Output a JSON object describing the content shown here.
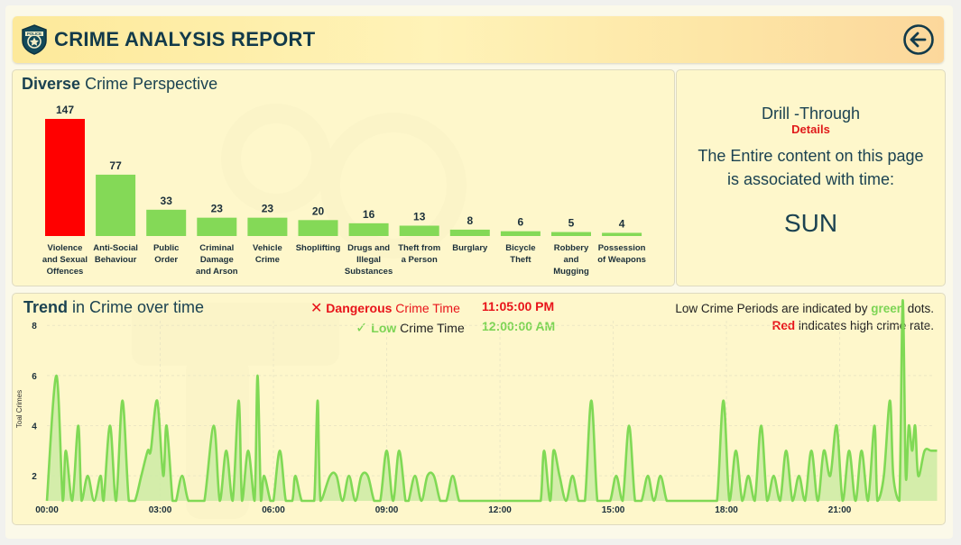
{
  "header": {
    "title": "CRIME ANALYSIS REPORT",
    "badge_text": "POLICE"
  },
  "crime_perspective": {
    "title_bold": "Diverse",
    "title_rest": " Crime Perspective"
  },
  "drill": {
    "title": "Drill -Through",
    "subtitle": "Details",
    "text": "The Entire content on this page is associated with time:",
    "value": "SUN"
  },
  "trend": {
    "title_bold": "Trend",
    "title_rest": " in Crime over time",
    "dangerous_word": "Dangerous",
    "dangerous_rest": " Crime Time",
    "dangerous_time": "11:05:00 PM",
    "low_word": "Low",
    "low_rest": " Crime Time",
    "low_time": "12:00:00 AM",
    "note1_pre": "Low Crime Periods are indicated by ",
    "note1_green": "green",
    "note1_post": " dots.",
    "note2_red": "Red",
    "note2_post": " indicates high crime rate.",
    "ylabel": "Toal Crimes"
  },
  "colors": {
    "high": "#ff0000",
    "normal": "#84d957",
    "line": "#80d955",
    "area": "#cdeba4",
    "text_dark": "#1b4251"
  },
  "chart_data": [
    {
      "type": "bar",
      "title": "Diverse Crime Perspective",
      "categories": [
        "Violence and Sexual Offences",
        "Anti-Social Behaviour",
        "Public Order",
        "Criminal Damage and Arson",
        "Vehicle Crime",
        "Shoplifting",
        "Drugs and Illegal Substances",
        "Theft from a Person",
        "Burglary",
        "Bicycle Theft",
        "Robbery and Mugging",
        "Possession of Weapons"
      ],
      "category_lines": [
        [
          "Violence",
          "and Sexual",
          "Offences"
        ],
        [
          "Anti-Social",
          "Behaviour"
        ],
        [
          "Public",
          "Order"
        ],
        [
          "Criminal",
          "Damage",
          "and Arson"
        ],
        [
          "Vehicle",
          "Crime"
        ],
        [
          "Shoplifting"
        ],
        [
          "Drugs and",
          "Illegal",
          "Substances"
        ],
        [
          "Theft from",
          "a Person"
        ],
        [
          "Burglary"
        ],
        [
          "Bicycle",
          "Theft"
        ],
        [
          "Robbery",
          "and",
          "Mugging"
        ],
        [
          "Possession",
          "of Weapons"
        ]
      ],
      "values": [
        147,
        77,
        33,
        23,
        23,
        20,
        16,
        13,
        8,
        6,
        5,
        4
      ],
      "highlight_index": 0
    },
    {
      "type": "area",
      "title": "Trend in Crime over time",
      "ylabel": "Toal Crimes",
      "x_ticks": [
        "00:00",
        "03:00",
        "06:00",
        "09:00",
        "12:00",
        "15:00",
        "18:00",
        "21:00"
      ],
      "x_range_hours": [
        0,
        24
      ],
      "y_ticks": [
        2,
        4,
        6,
        8
      ],
      "ylim": [
        1,
        9
      ],
      "series": [
        {
          "x": [
            0.0,
            0.25,
            0.42,
            0.5,
            0.67,
            0.83,
            0.92,
            1.08,
            1.25,
            1.42,
            1.5,
            1.67,
            1.83,
            2.0,
            2.17,
            2.33,
            2.5,
            2.67,
            2.75,
            2.92,
            3.08,
            3.17,
            3.33,
            3.42,
            3.58,
            3.75,
            4.0,
            4.17,
            4.42,
            4.58,
            4.75,
            4.92,
            5.08,
            5.17,
            5.33,
            5.5,
            5.58,
            5.67,
            5.75,
            5.92,
            6.0,
            6.17,
            6.33,
            6.5,
            6.58,
            6.75,
            6.92,
            7.08,
            7.17,
            7.25,
            7.5,
            7.67,
            7.83,
            8.0,
            8.17,
            8.33,
            8.5,
            8.67,
            8.83,
            9.0,
            9.17,
            9.33,
            9.5,
            9.58,
            9.75,
            9.92,
            10.08,
            10.25,
            10.42,
            10.58,
            10.75,
            10.92,
            11.08,
            11.25,
            11.42,
            11.58,
            11.75,
            11.92,
            12.08,
            12.25,
            12.42,
            12.58,
            12.75,
            12.92,
            13.08,
            13.17,
            13.33,
            13.42,
            13.58,
            13.75,
            13.92,
            14.08,
            14.25,
            14.42,
            14.58,
            14.75,
            14.92,
            15.08,
            15.25,
            15.42,
            15.58,
            15.75,
            15.92,
            16.08,
            16.25,
            16.42,
            16.58,
            16.75,
            16.92,
            17.08,
            17.25,
            17.42,
            17.58,
            17.75,
            17.92,
            18.08,
            18.25,
            18.42,
            18.58,
            18.75,
            18.92,
            19.08,
            19.25,
            19.42,
            19.58,
            19.75,
            19.92,
            20.08,
            20.25,
            20.42,
            20.58,
            20.75,
            20.92,
            21.08,
            21.25,
            21.42,
            21.58,
            21.75,
            21.92,
            22.0,
            22.17,
            22.33,
            22.42,
            22.58,
            22.67,
            22.75,
            22.83,
            22.92,
            23.0,
            23.08,
            23.25,
            23.42,
            23.58
          ],
          "y": [
            1,
            6,
            1,
            3,
            1,
            4,
            1,
            2,
            1,
            2,
            1,
            4,
            1,
            5,
            1,
            1,
            2,
            3,
            3,
            5,
            2,
            4,
            1,
            1,
            2,
            1,
            1,
            1,
            4,
            1,
            3,
            1,
            5,
            1,
            3,
            1,
            6,
            1,
            2,
            1,
            1,
            3,
            1,
            1,
            2,
            1,
            1,
            1,
            5,
            1,
            2,
            2,
            1,
            2,
            1,
            2,
            2,
            1,
            1,
            3,
            1,
            3,
            1,
            1,
            2,
            1,
            2,
            2,
            1,
            1,
            2,
            1,
            1,
            1,
            1,
            1,
            1,
            1,
            1,
            1,
            1,
            1,
            1,
            1,
            1,
            3,
            1,
            3,
            2,
            1,
            2,
            1,
            1,
            5,
            1,
            1,
            1,
            2,
            1,
            4,
            1,
            1,
            2,
            1,
            2,
            1,
            1,
            1,
            1,
            1,
            1,
            1,
            1,
            1,
            5,
            1,
            3,
            1,
            2,
            1,
            4,
            1,
            2,
            1,
            3,
            1,
            2,
            1,
            3,
            1,
            3,
            2,
            4,
            1,
            3,
            1,
            3,
            1,
            4,
            1,
            2,
            5,
            2,
            1,
            9,
            2,
            4,
            3,
            4,
            2,
            3,
            3,
            3
          ],
          "name": ""
        }
      ]
    }
  ]
}
